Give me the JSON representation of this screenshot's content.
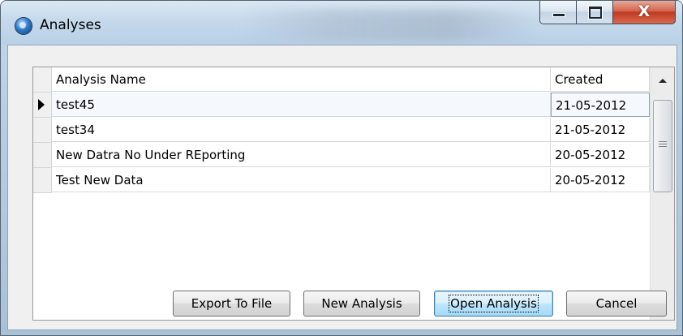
{
  "window": {
    "title": "Analyses",
    "close_glyph": "X"
  },
  "grid": {
    "columns": [
      "Analysis Name",
      "Created"
    ],
    "rows": [
      {
        "name": "test45",
        "created": "21-05-2012",
        "selected": true
      },
      {
        "name": "test34",
        "created": "21-05-2012",
        "selected": false
      },
      {
        "name": "New Datra No Under REporting",
        "created": "20-05-2012",
        "selected": false
      },
      {
        "name": "Test New Data",
        "created": "20-05-2012",
        "selected": false
      }
    ]
  },
  "buttons": {
    "export": "Export To File",
    "new": "New Analysis",
    "open": "Open Analysis",
    "cancel": "Cancel",
    "default_button": "open"
  },
  "icons": {
    "app": "app-orb-icon",
    "minimize": "minimize-icon",
    "maximize": "maximize-icon",
    "close": "close-icon",
    "row_pointer": "row-pointer-icon"
  },
  "colors": {
    "close_button": "#c03a21",
    "default_button_border": "#3c7fb1",
    "selected_row_border": "#8fa3bb"
  }
}
